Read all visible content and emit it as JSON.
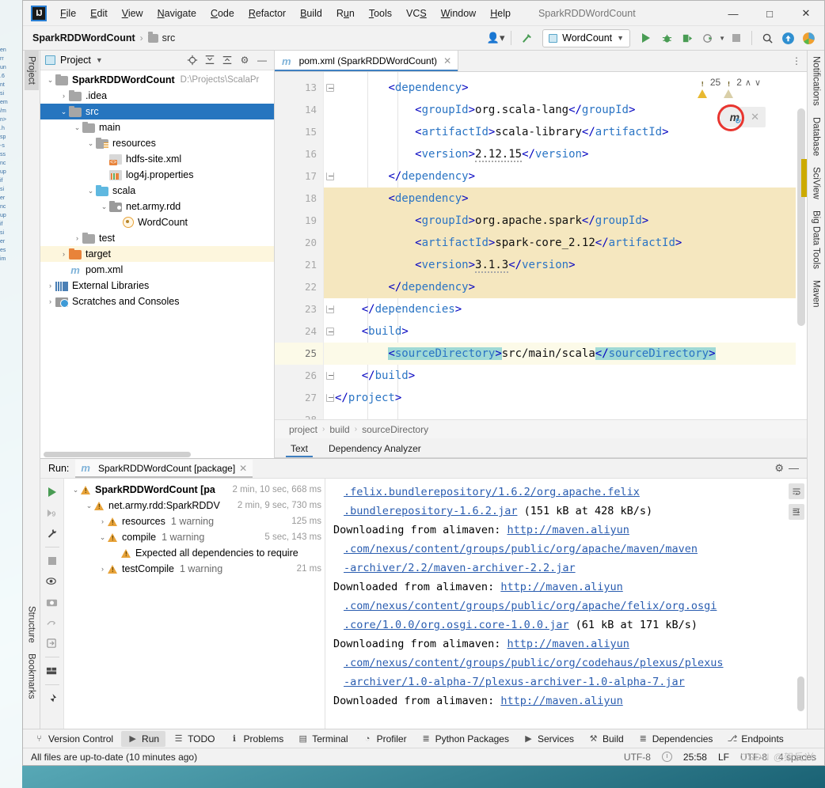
{
  "window": {
    "title": "SparkRDDWordCount",
    "logo": "IJ",
    "controls": {
      "minimize": "—",
      "maximize": "□",
      "close": "✕"
    }
  },
  "menubar": [
    {
      "label": "File",
      "mnemonic": "F"
    },
    {
      "label": "Edit",
      "mnemonic": "E"
    },
    {
      "label": "View",
      "mnemonic": "V"
    },
    {
      "label": "Navigate",
      "mnemonic": "N"
    },
    {
      "label": "Code",
      "mnemonic": "C"
    },
    {
      "label": "Refactor",
      "mnemonic": "R"
    },
    {
      "label": "Build",
      "mnemonic": "B"
    },
    {
      "label": "Run",
      "mnemonic": "u"
    },
    {
      "label": "Tools",
      "mnemonic": "T"
    },
    {
      "label": "VCS",
      "mnemonic": "S"
    },
    {
      "label": "Window",
      "mnemonic": "W"
    },
    {
      "label": "Help",
      "mnemonic": "H"
    }
  ],
  "navbar": {
    "breadcrumb": [
      {
        "label": "SparkRDDWordCount",
        "icon": "project-icon"
      },
      {
        "label": "src",
        "icon": "folder-icon"
      }
    ],
    "run_configuration": "WordCount",
    "icons": [
      "account-icon",
      "build-hammer-icon",
      "run-icon",
      "debug-icon",
      "run-with-coverage-icon",
      "profile-icon",
      "stop-icon",
      "search-everywhere-icon",
      "updates-icon",
      "ide-feature-icon"
    ]
  },
  "left_tool_strip": [
    "Project",
    "Structure",
    "Bookmarks"
  ],
  "right_tool_strip": [
    "Notifications",
    "Database",
    "SciView",
    "Big Data Tools",
    "Maven"
  ],
  "project_tool_window": {
    "title": "Project",
    "header_icons": [
      "locate-icon",
      "expand-all-icon",
      "collapse-all-icon",
      "settings-gear-icon",
      "hide-icon"
    ],
    "tree": [
      {
        "label": "SparkRDDWordCount",
        "note": "D:\\Projects\\ScalaPr",
        "indent": 0,
        "arrow": "⌄",
        "icon": "project-folder-icon",
        "bold": true,
        "state": "normal"
      },
      {
        "label": ".idea",
        "note": "",
        "indent": 1,
        "arrow": "›",
        "icon": "folder-grey-icon",
        "bold": false,
        "state": "normal"
      },
      {
        "label": "src",
        "note": "",
        "indent": 1,
        "arrow": "⌄",
        "icon": "folder-grey-icon",
        "bold": false,
        "state": "selected"
      },
      {
        "label": "main",
        "note": "",
        "indent": 2,
        "arrow": "⌄",
        "icon": "folder-grey-icon",
        "bold": false,
        "state": "normal"
      },
      {
        "label": "resources",
        "note": "",
        "indent": 3,
        "arrow": "⌄",
        "icon": "resources-folder-icon",
        "bold": false,
        "state": "normal"
      },
      {
        "label": "hdfs-site.xml",
        "note": "",
        "indent": 4,
        "arrow": "",
        "icon": "xml-file-icon",
        "bold": false,
        "state": "normal"
      },
      {
        "label": "log4j.properties",
        "note": "",
        "indent": 4,
        "arrow": "",
        "icon": "properties-file-icon",
        "bold": false,
        "state": "normal"
      },
      {
        "label": "scala",
        "note": "",
        "indent": 3,
        "arrow": "⌄",
        "icon": "source-folder-icon",
        "bold": false,
        "state": "normal"
      },
      {
        "label": "net.army.rdd",
        "note": "",
        "indent": 4,
        "arrow": "⌄",
        "icon": "package-icon",
        "bold": false,
        "state": "normal"
      },
      {
        "label": "WordCount",
        "note": "",
        "indent": 5,
        "arrow": "",
        "icon": "scala-object-icon",
        "bold": false,
        "state": "normal"
      },
      {
        "label": "test",
        "note": "",
        "indent": 2,
        "arrow": "›",
        "icon": "folder-grey-icon",
        "bold": false,
        "state": "normal"
      },
      {
        "label": "target",
        "note": "",
        "indent": 1,
        "arrow": "›",
        "icon": "folder-orange-icon",
        "bold": false,
        "state": "highlight"
      },
      {
        "label": "pom.xml",
        "note": "",
        "indent": 1,
        "arrow": "",
        "icon": "maven-file-icon",
        "bold": false,
        "state": "normal"
      },
      {
        "label": "External Libraries",
        "note": "",
        "indent": 0,
        "arrow": "›",
        "icon": "libraries-icon",
        "bold": false,
        "state": "normal"
      },
      {
        "label": "Scratches and Consoles",
        "note": "",
        "indent": 0,
        "arrow": "›",
        "icon": "scratches-icon",
        "bold": false,
        "state": "normal"
      }
    ]
  },
  "editor": {
    "tab": {
      "label": "pom.xml (SparkRDDWordCount)",
      "icon": "maven-file-icon",
      "close": "✕"
    },
    "inspections": {
      "warning_count": "25",
      "weak_warning_count": "2",
      "prev": "∧",
      "next": "∨"
    },
    "maven_popup": {
      "icon": "maven-reload-icon",
      "close": "✕"
    },
    "first_line_number": 13,
    "lines": [
      {
        "n": 13,
        "indent": 2,
        "fold": "start",
        "hl": false,
        "cur": false,
        "tokens": [
          {
            "t": "<",
            "c": "tagb"
          },
          {
            "t": "dependency",
            "c": "tagn"
          },
          {
            "t": ">",
            "c": "tagb"
          }
        ]
      },
      {
        "n": 14,
        "indent": 3,
        "fold": "",
        "hl": false,
        "cur": false,
        "tokens": [
          {
            "t": "<",
            "c": "tagb"
          },
          {
            "t": "groupId",
            "c": "tagn"
          },
          {
            "t": ">",
            "c": "tagb"
          },
          {
            "t": "org.scala-lang",
            "c": "txt"
          },
          {
            "t": "</",
            "c": "tagb"
          },
          {
            "t": "groupId",
            "c": "tagn"
          },
          {
            "t": ">",
            "c": "tagb"
          }
        ]
      },
      {
        "n": 15,
        "indent": 3,
        "fold": "",
        "hl": false,
        "cur": false,
        "tokens": [
          {
            "t": "<",
            "c": "tagb"
          },
          {
            "t": "artifactId",
            "c": "tagn"
          },
          {
            "t": ">",
            "c": "tagb"
          },
          {
            "t": "scala-library",
            "c": "txt"
          },
          {
            "t": "</",
            "c": "tagb"
          },
          {
            "t": "artifactId",
            "c": "tagn"
          },
          {
            "t": ">",
            "c": "tagb"
          }
        ]
      },
      {
        "n": 16,
        "indent": 3,
        "fold": "",
        "hl": false,
        "cur": false,
        "tokens": [
          {
            "t": "<",
            "c": "tagb"
          },
          {
            "t": "version",
            "c": "tagn"
          },
          {
            "t": ">",
            "c": "tagb"
          },
          {
            "t": "2.12.15",
            "c": "txt squig"
          },
          {
            "t": "</",
            "c": "tagb"
          },
          {
            "t": "version",
            "c": "tagn"
          },
          {
            "t": ">",
            "c": "tagb"
          }
        ]
      },
      {
        "n": 17,
        "indent": 2,
        "fold": "end",
        "hl": false,
        "cur": false,
        "tokens": [
          {
            "t": "</",
            "c": "tagb"
          },
          {
            "t": "dependency",
            "c": "tagn"
          },
          {
            "t": ">",
            "c": "tagb"
          }
        ]
      },
      {
        "n": 18,
        "indent": 2,
        "fold": "start",
        "hl": true,
        "cur": false,
        "tokens": [
          {
            "t": "<",
            "c": "tagb"
          },
          {
            "t": "dependency",
            "c": "tagn"
          },
          {
            "t": ">",
            "c": "tagb"
          }
        ]
      },
      {
        "n": 19,
        "indent": 3,
        "fold": "",
        "hl": true,
        "cur": false,
        "tokens": [
          {
            "t": "<",
            "c": "tagb"
          },
          {
            "t": "groupId",
            "c": "tagn"
          },
          {
            "t": ">",
            "c": "tagb"
          },
          {
            "t": "org.apache.spark",
            "c": "txt"
          },
          {
            "t": "</",
            "c": "tagb"
          },
          {
            "t": "groupId",
            "c": "tagn"
          },
          {
            "t": ">",
            "c": "tagb"
          }
        ]
      },
      {
        "n": 20,
        "indent": 3,
        "fold": "",
        "hl": true,
        "cur": false,
        "tokens": [
          {
            "t": "<",
            "c": "tagb"
          },
          {
            "t": "artifactId",
            "c": "tagn"
          },
          {
            "t": ">",
            "c": "tagb"
          },
          {
            "t": "spark-core_2.12",
            "c": "txt"
          },
          {
            "t": "</",
            "c": "tagb"
          },
          {
            "t": "artifactId",
            "c": "tagn"
          },
          {
            "t": ">",
            "c": "tagb"
          }
        ]
      },
      {
        "n": 21,
        "indent": 3,
        "fold": "",
        "hl": true,
        "cur": false,
        "tokens": [
          {
            "t": "<",
            "c": "tagb"
          },
          {
            "t": "version",
            "c": "tagn"
          },
          {
            "t": ">",
            "c": "tagb"
          },
          {
            "t": "3.1.3",
            "c": "txt squig"
          },
          {
            "t": "</",
            "c": "tagb"
          },
          {
            "t": "version",
            "c": "tagn"
          },
          {
            "t": ">",
            "c": "tagb"
          }
        ]
      },
      {
        "n": 22,
        "indent": 2,
        "fold": "end",
        "hl": true,
        "cur": false,
        "tokens": [
          {
            "t": "</",
            "c": "tagb"
          },
          {
            "t": "dependency",
            "c": "tagn"
          },
          {
            "t": ">",
            "c": "tagb"
          }
        ]
      },
      {
        "n": 23,
        "indent": 1,
        "fold": "end",
        "hl": false,
        "cur": false,
        "tokens": [
          {
            "t": "</",
            "c": "tagb"
          },
          {
            "t": "dependencies",
            "c": "tagn"
          },
          {
            "t": ">",
            "c": "tagb"
          }
        ]
      },
      {
        "n": 24,
        "indent": 1,
        "fold": "start",
        "hl": false,
        "cur": false,
        "tokens": [
          {
            "t": "<",
            "c": "tagb"
          },
          {
            "t": "build",
            "c": "tagn"
          },
          {
            "t": ">",
            "c": "tagb"
          }
        ]
      },
      {
        "n": 25,
        "indent": 2,
        "fold": "",
        "hl": false,
        "cur": true,
        "tokens": [
          {
            "t": "<",
            "c": "tagb sel-tok"
          },
          {
            "t": "sourceDirectory",
            "c": "tagn sel-tok"
          },
          {
            "t": ">",
            "c": "tagb sel-tok"
          },
          {
            "t": "src/main/scala",
            "c": "txt"
          },
          {
            "t": "</",
            "c": "tagb sel-tok"
          },
          {
            "t": "sourceDirectory",
            "c": "tagn sel-tok"
          },
          {
            "t": ">",
            "c": "tagb sel-tok"
          }
        ]
      },
      {
        "n": 26,
        "indent": 1,
        "fold": "end",
        "hl": false,
        "cur": false,
        "tokens": [
          {
            "t": "</",
            "c": "tagb"
          },
          {
            "t": "build",
            "c": "tagn"
          },
          {
            "t": ">",
            "c": "tagb"
          }
        ]
      },
      {
        "n": 27,
        "indent": 0,
        "fold": "end",
        "hl": false,
        "cur": false,
        "tokens": [
          {
            "t": "</",
            "c": "tagb"
          },
          {
            "t": "project",
            "c": "tagn"
          },
          {
            "t": ">",
            "c": "tagb"
          }
        ]
      },
      {
        "n": 28,
        "indent": 0,
        "fold": "",
        "hl": false,
        "cur": false,
        "tokens": []
      }
    ],
    "breadcrumb": [
      "project",
      "build",
      "sourceDirectory"
    ],
    "bottom_tabs": [
      {
        "label": "Text",
        "selected": true
      },
      {
        "label": "Dependency Analyzer",
        "selected": false
      }
    ]
  },
  "run_tool_window": {
    "label": "Run:",
    "tab": {
      "label": "SparkRDDWordCount [package]",
      "icon": "maven-file-icon",
      "close": "✕"
    },
    "header_icons": [
      "settings-gear-icon",
      "hide-icon"
    ],
    "side_icons": [
      "rerun-icon",
      "rerun-failed-icon",
      "toggle-tasks-icon",
      "stop-icon",
      "eye-filter-icon",
      "camera-icon",
      "skip-tests-icon",
      "download-sources-icon",
      "layout-icon",
      "pin-icon"
    ],
    "tree": [
      {
        "indent": 0,
        "arrow": "⌄",
        "label": "SparkRDDWordCount [pa",
        "bold": true,
        "sub": "",
        "dur": "2 min, 10 sec, 668 ms"
      },
      {
        "indent": 1,
        "arrow": "⌄",
        "label": "net.army.rdd:SparkRDDV",
        "bold": false,
        "sub": "",
        "dur": "2 min, 9 sec, 730 ms"
      },
      {
        "indent": 2,
        "arrow": "›",
        "label": "resources",
        "bold": false,
        "sub": "1 warning",
        "dur": "125 ms"
      },
      {
        "indent": 2,
        "arrow": "⌄",
        "label": "compile",
        "bold": false,
        "sub": "1 warning",
        "dur": "5 sec, 143 ms"
      },
      {
        "indent": 3,
        "arrow": "",
        "label": "Expected all dependencies to require",
        "bold": false,
        "sub": "",
        "dur": ""
      },
      {
        "indent": 2,
        "arrow": "›",
        "label": "testCompile",
        "bold": false,
        "sub": "1 warning",
        "dur": "21 ms"
      }
    ],
    "console": [
      {
        "indent": 1,
        "parts": [
          {
            "t": ".felix.bundlerepository/1.6.2/org.apache.felix",
            "link": true
          }
        ]
      },
      {
        "indent": 1,
        "parts": [
          {
            "t": ".bundlerepository-1.6.2.jar",
            "link": true
          },
          {
            "t": " (151 kB at 428 kB/s)",
            "link": false
          }
        ]
      },
      {
        "indent": 0,
        "parts": [
          {
            "t": "Downloading from alimaven: ",
            "link": false
          },
          {
            "t": "http://maven.aliyun",
            "link": true
          }
        ]
      },
      {
        "indent": 1,
        "parts": [
          {
            "t": ".com/nexus/content/groups/public/org/apache/maven/maven",
            "link": true
          }
        ]
      },
      {
        "indent": 1,
        "parts": [
          {
            "t": "-archiver/2.2/maven-archiver-2.2.jar",
            "link": true
          }
        ]
      },
      {
        "indent": 0,
        "parts": [
          {
            "t": "Downloaded from alimaven: ",
            "link": false
          },
          {
            "t": "http://maven.aliyun",
            "link": true
          }
        ]
      },
      {
        "indent": 1,
        "parts": [
          {
            "t": ".com/nexus/content/groups/public/org/apache/felix/org.osgi",
            "link": true
          }
        ]
      },
      {
        "indent": 1,
        "parts": [
          {
            "t": ".core/1.0.0/org.osgi.core-1.0.0.jar",
            "link": true
          },
          {
            "t": " (61 kB at 171 kB/s)",
            "link": false
          }
        ]
      },
      {
        "indent": 0,
        "parts": [
          {
            "t": "Downloading from alimaven: ",
            "link": false
          },
          {
            "t": "http://maven.aliyun",
            "link": true
          }
        ]
      },
      {
        "indent": 1,
        "parts": [
          {
            "t": ".com/nexus/content/groups/public/org/codehaus/plexus/plexus",
            "link": true
          }
        ]
      },
      {
        "indent": 1,
        "parts": [
          {
            "t": "-archiver/1.0-alpha-7/plexus-archiver-1.0-alpha-7.jar",
            "link": true
          }
        ]
      },
      {
        "indent": 0,
        "parts": [
          {
            "t": "Downloaded from alimaven: ",
            "link": false
          },
          {
            "t": "http://maven.aliyun",
            "link": true
          }
        ]
      }
    ],
    "console_buttons": [
      "soft-wrap-icon",
      "scroll-to-end-icon"
    ]
  },
  "bottom_tool_strip": [
    {
      "label": "Version Control",
      "icon": "branch-icon",
      "selected": false
    },
    {
      "label": "Run",
      "icon": "run-icon",
      "selected": true
    },
    {
      "label": "TODO",
      "icon": "list-icon",
      "selected": false
    },
    {
      "label": "Problems",
      "icon": "info-icon",
      "selected": false
    },
    {
      "label": "Terminal",
      "icon": "terminal-icon",
      "selected": false
    },
    {
      "label": "Profiler",
      "icon": "profiler-icon",
      "selected": false
    },
    {
      "label": "Python Packages",
      "icon": "stack-icon",
      "selected": false
    },
    {
      "label": "Services",
      "icon": "services-icon",
      "selected": false
    },
    {
      "label": "Build",
      "icon": "hammer-icon",
      "selected": false
    },
    {
      "label": "Dependencies",
      "icon": "stack-icon",
      "selected": false
    },
    {
      "label": "Endpoints",
      "icon": "endpoints-icon",
      "selected": false
    }
  ],
  "statusbar": {
    "message": "All files are up-to-date (10 minutes ago)",
    "encoding_left": "UTF-8",
    "position": "25:58",
    "line_separator": "LF",
    "encoding_right": "UTF-8",
    "indent": "4 spaces",
    "watermark": "CSDN @架反兴"
  }
}
